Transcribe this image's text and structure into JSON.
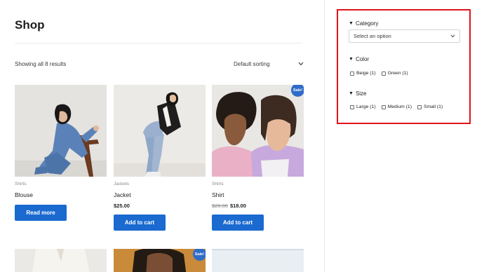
{
  "page": {
    "title": "Shop",
    "result_count": "Showing all 8 results",
    "sorting": "Default sorting"
  },
  "products": [
    {
      "category": "Shirts",
      "name": "Blouse",
      "button": "Read more"
    },
    {
      "category": "Jackets",
      "name": "Jacket",
      "price": "$25.00",
      "button": "Add to cart"
    },
    {
      "category": "Shirts",
      "name": "Shirt",
      "old_price": "$20.00",
      "price": "$18.00",
      "button": "Add to cart",
      "badge": "Sale!"
    }
  ],
  "row2": {
    "badge": "Sale!"
  },
  "filters": {
    "category": {
      "label": "Category",
      "placeholder": "Select an option"
    },
    "color": {
      "label": "Color",
      "options": [
        "Beige (1)",
        "Green (1)"
      ]
    },
    "size": {
      "label": "Size",
      "options": [
        "Large (1)",
        "Medium (1)",
        "Small (1)"
      ]
    }
  },
  "colors": {
    "accent": "#1a6ad0",
    "badge": "#2f6cc8",
    "highlight": "#e0131a"
  }
}
